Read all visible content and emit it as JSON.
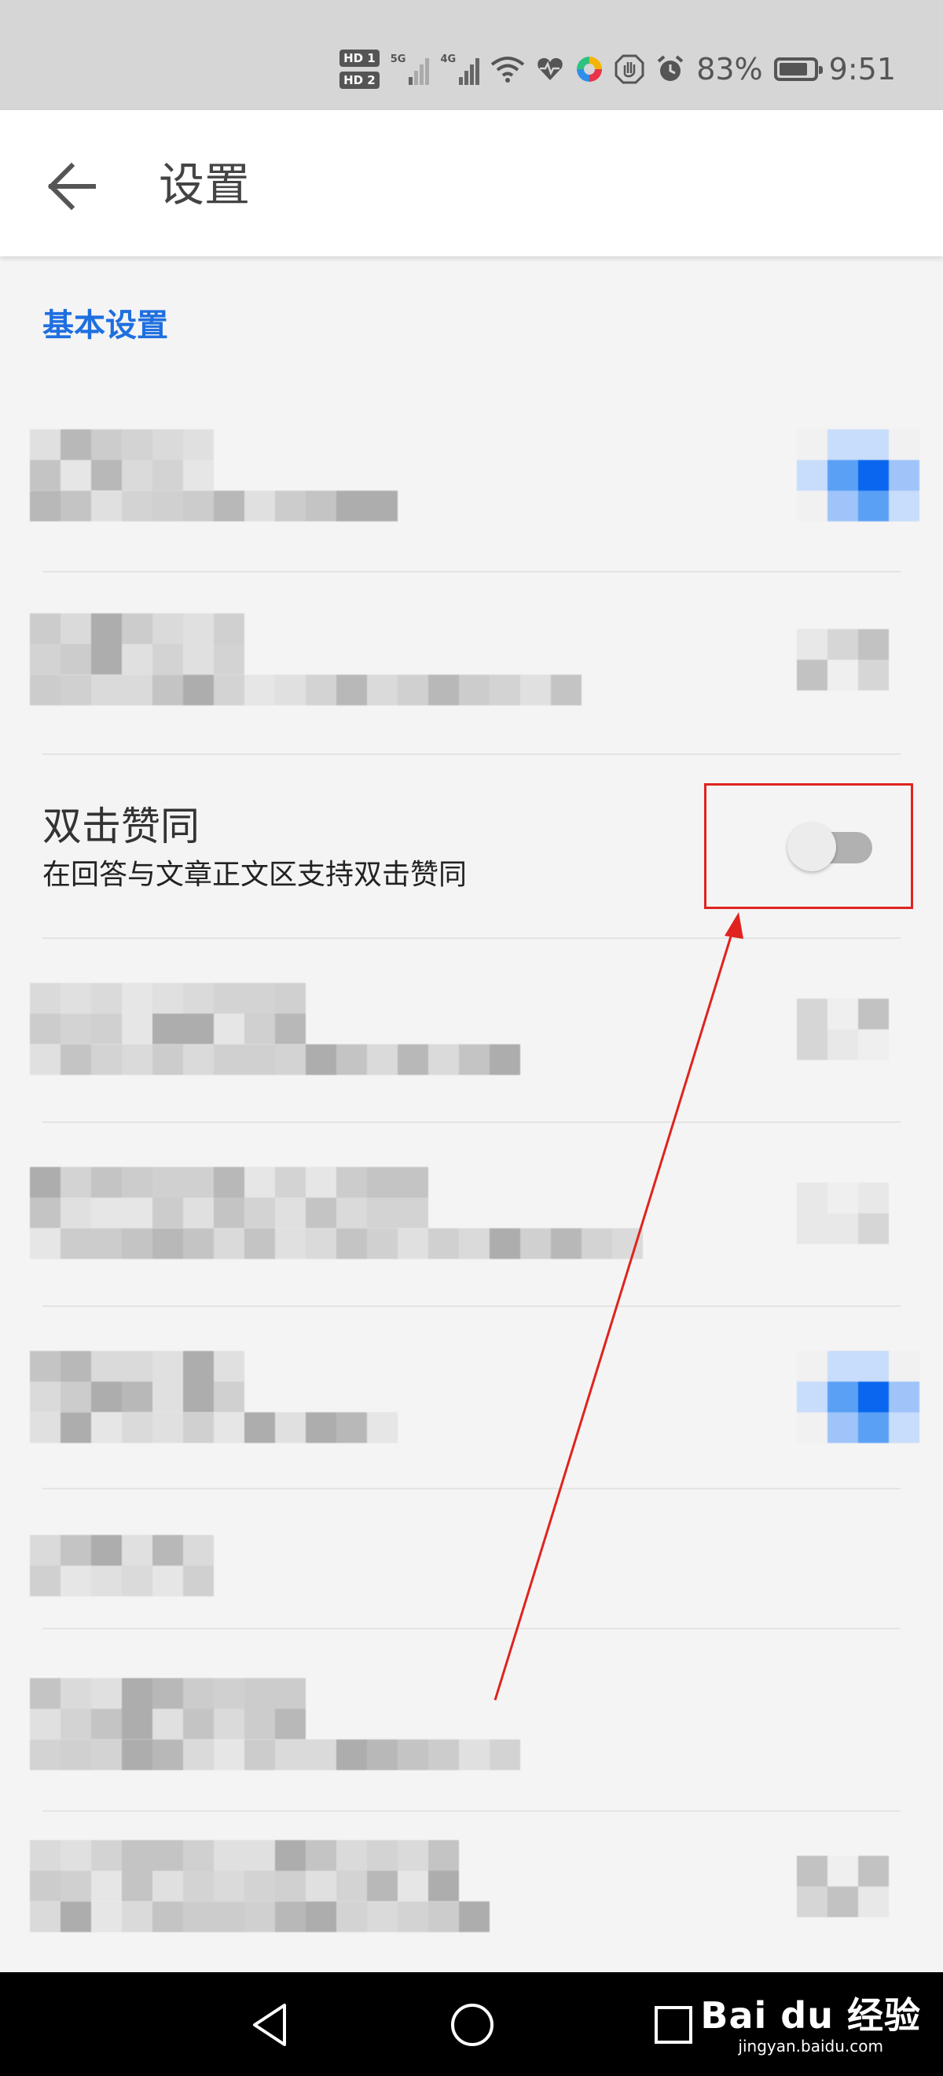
{
  "status_bar": {
    "sim1": "HD 1",
    "sim2": "HD 2",
    "net1": "5G",
    "net2": "4G",
    "battery_percent": "83%",
    "battery_level": 0.83,
    "time": "9:51",
    "icons": [
      "wifi-icon",
      "health-icon",
      "color-app-icon",
      "hand-stop-icon",
      "alarm-icon",
      "battery-icon"
    ]
  },
  "app_bar": {
    "title": "设置",
    "back_icon": "arrow-left-icon"
  },
  "section": {
    "title": "基本设置"
  },
  "settings": {
    "double_tap": {
      "title": "双击赞同",
      "subtitle": "在回答与文章正文区支持双击赞同",
      "enabled": false
    }
  },
  "annotation": {
    "color": "#e0231f"
  },
  "nav_bar": {
    "icons": [
      "back-triangle-icon",
      "home-circle-icon",
      "recents-square-icon"
    ]
  },
  "watermark": {
    "brand": "Bai du 经验",
    "site": "jingyan.baidu.com"
  },
  "colors": {
    "accent": "#1e6fe0",
    "background": "#f4f4f4"
  }
}
